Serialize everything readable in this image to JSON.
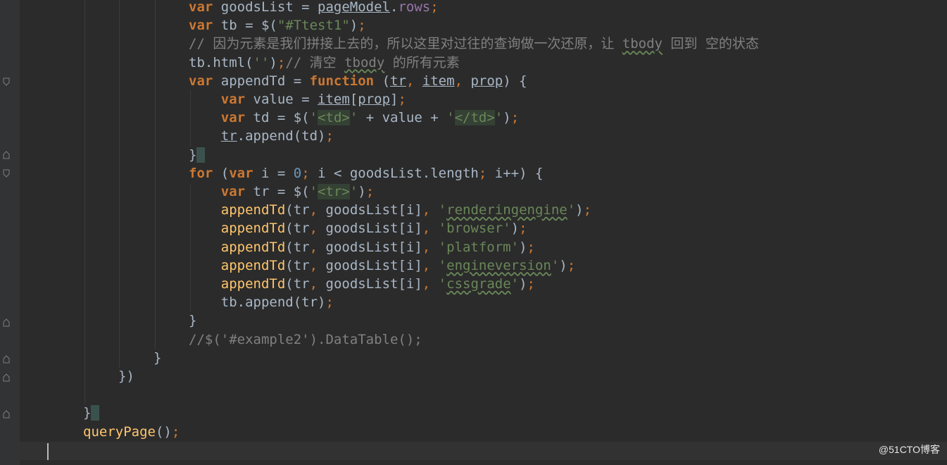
{
  "editor": {
    "lines": [
      {
        "indent": "",
        "segs": [
          [
            "kw",
            "var "
          ],
          [
            "plain",
            "goodsList "
          ],
          [
            "plain",
            "= "
          ],
          [
            "plain ul",
            "pageModel"
          ],
          [
            "plain",
            "."
          ],
          [
            "prop",
            "rows"
          ],
          [
            "punc",
            ";"
          ]
        ]
      },
      {
        "indent": "",
        "segs": [
          [
            "kw",
            "var "
          ],
          [
            "plain",
            "tb = $("
          ],
          [
            "str",
            "\"#Ttest1\""
          ],
          [
            "plain",
            ")"
          ],
          [
            "punc",
            ";"
          ]
        ]
      },
      {
        "indent": "",
        "segs": [
          [
            "cmt",
            "// 因为元素是我们拼接上去的，所以这里对过往的查询做一次还原，让 "
          ],
          [
            "cmt squig",
            "tbody"
          ],
          [
            "cmt",
            " 回到 空的状态"
          ]
        ]
      },
      {
        "indent": "",
        "segs": [
          [
            "plain",
            "tb.html("
          ],
          [
            "str",
            "''"
          ],
          [
            "plain",
            ")"
          ],
          [
            "punc",
            ";"
          ],
          [
            "cmt",
            "// 清空 "
          ],
          [
            "cmt squig",
            "tbody"
          ],
          [
            "cmt",
            " 的所有元素"
          ]
        ]
      },
      {
        "indent": "",
        "segs": [
          [
            "kw",
            "var "
          ],
          [
            "plain",
            "appendTd = "
          ],
          [
            "kw",
            "function "
          ],
          [
            "plain",
            "("
          ],
          [
            "plain ul",
            "tr"
          ],
          [
            "punc",
            ", "
          ],
          [
            "plain ul",
            "item"
          ],
          [
            "punc",
            ", "
          ],
          [
            "plain ul",
            "prop"
          ],
          [
            "plain",
            ") {"
          ]
        ]
      },
      {
        "indent": "    ",
        "segs": [
          [
            "kw",
            "var "
          ],
          [
            "plain",
            "value = "
          ],
          [
            "plain ul",
            "item"
          ],
          [
            "plain",
            "["
          ],
          [
            "plain ul",
            "prop"
          ],
          [
            "plain",
            "]"
          ],
          [
            "punc",
            ";"
          ]
        ]
      },
      {
        "indent": "    ",
        "segs": [
          [
            "kw",
            "var "
          ],
          [
            "plain",
            "td = $("
          ],
          [
            "str",
            "'"
          ],
          [
            "str tagbg",
            "<td>"
          ],
          [
            "str",
            "'"
          ],
          [
            "plain",
            " + value + "
          ],
          [
            "str",
            "'"
          ],
          [
            "str tagbg",
            "</td>"
          ],
          [
            "str",
            "'"
          ],
          [
            "plain",
            ")"
          ],
          [
            "punc",
            ";"
          ]
        ]
      },
      {
        "indent": "    ",
        "segs": [
          [
            "plain ul",
            "tr"
          ],
          [
            "plain",
            ".append(td)"
          ],
          [
            "punc",
            ";"
          ]
        ]
      },
      {
        "indent": "",
        "segs": [
          [
            "plain",
            "}"
          ],
          [
            "bracehl",
            " "
          ]
        ]
      },
      {
        "indent": "",
        "segs": [
          [
            "kw",
            "for "
          ],
          [
            "plain",
            "("
          ],
          [
            "kw",
            "var "
          ],
          [
            "plain",
            "i = "
          ],
          [
            "num",
            "0"
          ],
          [
            "punc",
            "; "
          ],
          [
            "plain",
            "i < goodsList.length"
          ],
          [
            "punc",
            "; "
          ],
          [
            "plain",
            "i++) {"
          ]
        ]
      },
      {
        "indent": "    ",
        "segs": [
          [
            "kw",
            "var "
          ],
          [
            "plain",
            "tr = $("
          ],
          [
            "str",
            "'"
          ],
          [
            "str tagbg",
            "<tr>"
          ],
          [
            "str",
            "'"
          ],
          [
            "plain",
            ")"
          ],
          [
            "punc",
            ";"
          ]
        ]
      },
      {
        "indent": "    ",
        "segs": [
          [
            "fn",
            "appendTd"
          ],
          [
            "plain",
            "(tr"
          ],
          [
            "punc",
            ", "
          ],
          [
            "plain",
            "goodsList[i]"
          ],
          [
            "punc",
            ", "
          ],
          [
            "str",
            "'"
          ],
          [
            "str squig",
            "renderingengine"
          ],
          [
            "str",
            "'"
          ],
          [
            "plain",
            ")"
          ],
          [
            "punc",
            ";"
          ]
        ]
      },
      {
        "indent": "    ",
        "segs": [
          [
            "fn",
            "appendTd"
          ],
          [
            "plain",
            "(tr"
          ],
          [
            "punc",
            ", "
          ],
          [
            "plain",
            "goodsList[i]"
          ],
          [
            "punc",
            ", "
          ],
          [
            "str",
            "'browser'"
          ],
          [
            "plain",
            ")"
          ],
          [
            "punc",
            ";"
          ]
        ]
      },
      {
        "indent": "    ",
        "segs": [
          [
            "fn",
            "appendTd"
          ],
          [
            "plain",
            "(tr"
          ],
          [
            "punc",
            ", "
          ],
          [
            "plain",
            "goodsList[i]"
          ],
          [
            "punc",
            ", "
          ],
          [
            "str",
            "'platform'"
          ],
          [
            "plain",
            ")"
          ],
          [
            "punc",
            ";"
          ]
        ]
      },
      {
        "indent": "    ",
        "segs": [
          [
            "fn",
            "appendTd"
          ],
          [
            "plain",
            "(tr"
          ],
          [
            "punc",
            ", "
          ],
          [
            "plain",
            "goodsList[i]"
          ],
          [
            "punc",
            ", "
          ],
          [
            "str",
            "'"
          ],
          [
            "str squig",
            "engineversion"
          ],
          [
            "str",
            "'"
          ],
          [
            "plain",
            ")"
          ],
          [
            "punc",
            ";"
          ]
        ]
      },
      {
        "indent": "    ",
        "segs": [
          [
            "fn",
            "appendTd"
          ],
          [
            "plain",
            "(tr"
          ],
          [
            "punc",
            ", "
          ],
          [
            "plain",
            "goodsList[i]"
          ],
          [
            "punc",
            ", "
          ],
          [
            "str",
            "'"
          ],
          [
            "str squig",
            "cssgrade"
          ],
          [
            "str",
            "'"
          ],
          [
            "plain",
            ")"
          ],
          [
            "punc",
            ";"
          ]
        ]
      },
      {
        "indent": "    ",
        "segs": [
          [
            "plain",
            "tb.append(tr)"
          ],
          [
            "punc",
            ";"
          ]
        ]
      },
      {
        "indent": "",
        "segs": [
          [
            "plain",
            "}"
          ]
        ]
      },
      {
        "indent": "",
        "segs": [
          [
            "cmt",
            "//$('#example2').DataTable();"
          ]
        ]
      },
      {
        "indent": "",
        "segs": [
          [
            "plain",
            "}"
          ]
        ]
      },
      {
        "indent": "",
        "segs": [
          [
            "plain",
            "})"
          ]
        ]
      },
      {
        "indent": "",
        "segs": []
      },
      {
        "indent": "",
        "segs": [
          [
            "plain",
            "}"
          ],
          [
            "bracehl",
            " "
          ]
        ]
      },
      {
        "indent": "",
        "segs": [
          [
            "fn",
            "queryPage"
          ],
          [
            "plain",
            "()"
          ],
          [
            "punc",
            ";"
          ]
        ]
      },
      {
        "indent": "",
        "segs": []
      }
    ]
  },
  "watermark": "@51CTO博客"
}
